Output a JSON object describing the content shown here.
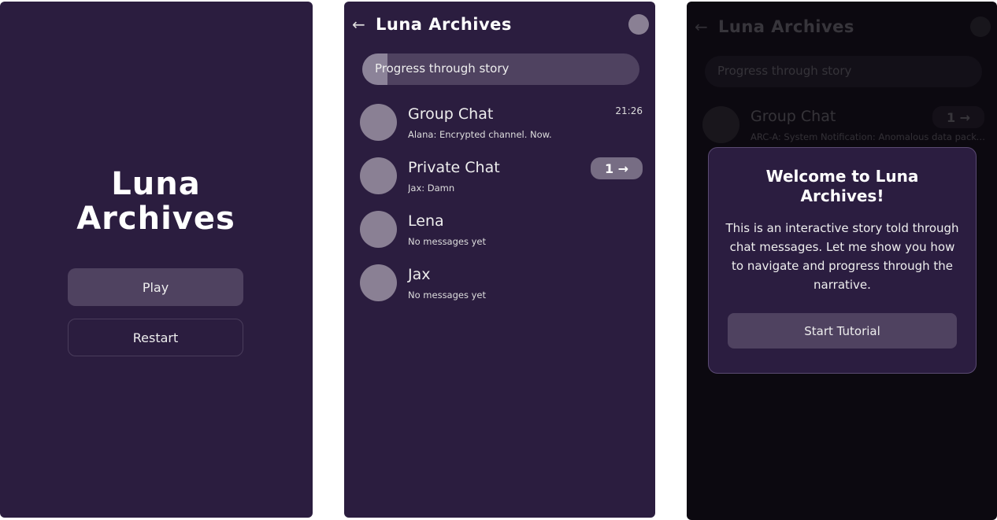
{
  "title_screen": {
    "title": "Luna Archives",
    "play": "Play",
    "restart": "Restart"
  },
  "chat_list": {
    "back": "←",
    "title": "Luna Archives",
    "progress_label": "Progress through story",
    "progress_percent": 9,
    "chats": [
      {
        "name": "Group Chat",
        "preview": "Alana: Encrypted channel. Now.",
        "time": "21:26"
      },
      {
        "name": "Private Chat",
        "preview": "Jax: Damn",
        "badge": "1 →"
      },
      {
        "name": "Lena",
        "preview": "No messages yet"
      },
      {
        "name": "Jax",
        "preview": "No messages yet"
      }
    ]
  },
  "tutorial": {
    "back": "←",
    "title": "Luna Archives",
    "progress_label": "Progress through story",
    "chat": {
      "name": "Group Chat",
      "preview": "ARC-A: System Notification: Anomalous data packet ...",
      "badge": "1 →"
    },
    "modal_title": "Welcome to Luna Archives!",
    "modal_body": "This is an interactive story told through chat messages. Let me show you how to navigate and progress through the narrative.",
    "start": "Start Tutorial"
  }
}
